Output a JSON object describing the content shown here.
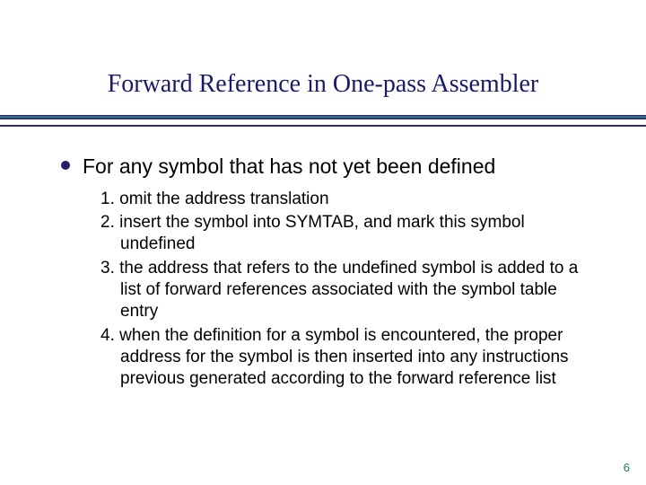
{
  "title": "Forward Reference in One-pass Assembler",
  "level1": "For any symbol that has not yet been defined",
  "items": {
    "i1": "1. omit the address translation",
    "i2": "2. insert the symbol into SYMTAB, and mark this symbol undefined",
    "i3": "3. the address that refers to the undefined symbol is added to a list of forward references associated with the symbol table entry",
    "i4": "4. when the definition for a symbol is encountered, the proper address for the symbol is then inserted into any instructions previous generated according to the forward reference list"
  },
  "page_number": "6"
}
